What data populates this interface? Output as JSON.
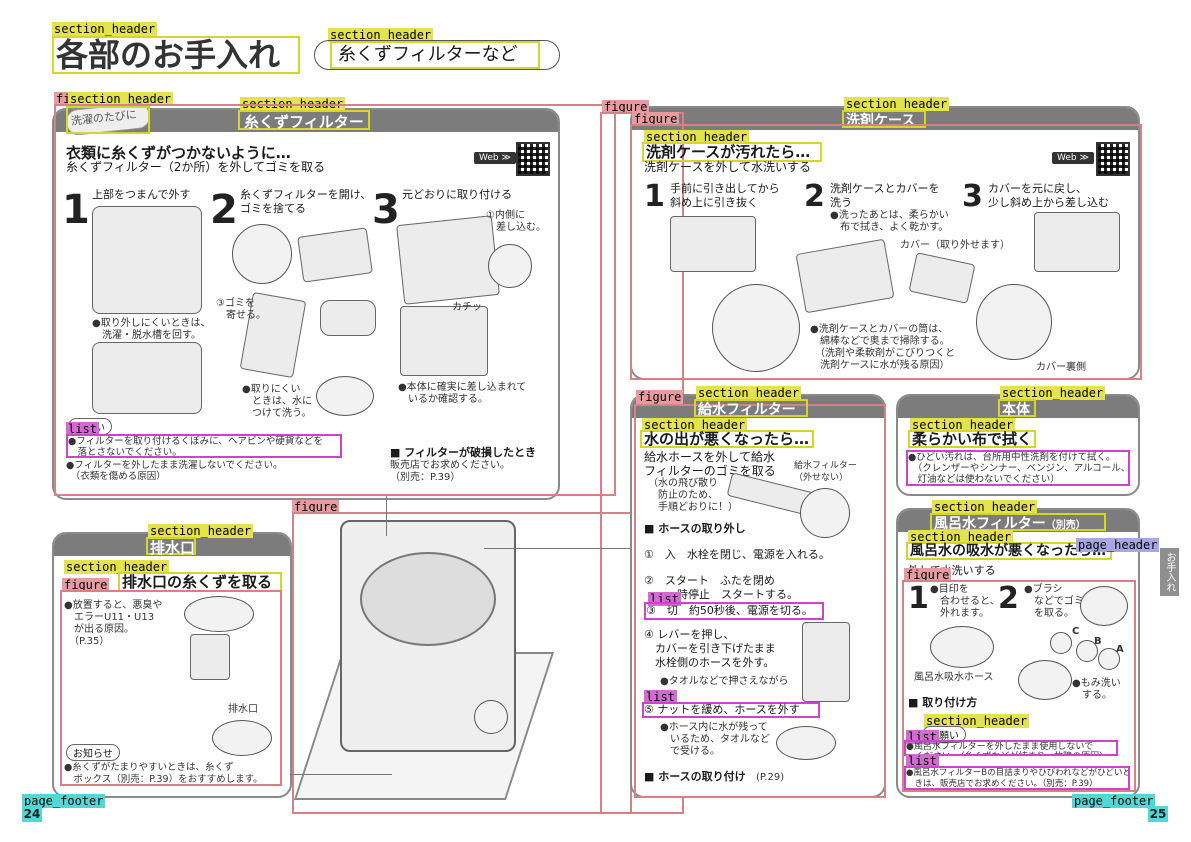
{
  "title": {
    "main": "各部のお手入れ",
    "sub": "糸くずフィルターなど"
  },
  "tags": {
    "section_header": "section_header",
    "figure": "figure",
    "list": "list",
    "page_footer": "page_footer",
    "page_header": "page_header"
  },
  "lint": {
    "band": "糸くずフィルター",
    "badge": "洗濯のたびに",
    "heading": "衣類に糸くずがつかないように…",
    "subheading": "糸くずフィルター（2か所）を外してゴミを取る",
    "web": "Web ≫",
    "steps": [
      {
        "num": "1",
        "text": "上部をつまんで外す"
      },
      {
        "num": "2",
        "text": "糸くずフィルターを開け、\nゴミを捨てる"
      },
      {
        "num": "3",
        "text": "元どおりに取り付ける"
      }
    ],
    "notes": {
      "n1": "●取り外しにくいときは、\n　洗濯・脱水槽を回す。",
      "n2": "③ゴミを\n　寄せる。",
      "n3": "●取りにくい\n　ときは、水に\n　つけて洗う。",
      "n4": "●本体に確実に差し込まれて\n　いるか確認する。",
      "n5": "①内側に\n　差し込む。",
      "click": "カチッ"
    },
    "caution_label": "お願い",
    "caution_items": [
      "●フィルターを取り付けるくぼみに、ヘアピンや硬貨などを\n　落とさないでください。",
      "●フィルターを外したまま洗濯しないでください。\n　（衣類を傷める原因）"
    ],
    "broken_title": "■ フィルターが破損したとき",
    "broken_text": "販売店でお求めください。\n（別売：P.39）"
  },
  "drain": {
    "band": "排水口",
    "heading": "排水口の糸くずを取る",
    "note": "●放置すると、悪臭や\n　エラーU11・U13\n　が出る原因。\n　（P.35）",
    "part_label": "排水口",
    "info_label": "お知らせ",
    "info_text": "●糸くずがたまりやすいときは、糸くず\n　ボックス（別売：P.39）をおすすめします。"
  },
  "detergent": {
    "band": "洗剤ケース",
    "heading": "洗剤ケースが汚れたら…",
    "subheading": "洗剤ケースを外して水洗いする",
    "web": "Web ≫",
    "steps": [
      {
        "num": "1",
        "text": "手前に引き出してから\n斜め上に引き抜く"
      },
      {
        "num": "2",
        "text": "洗剤ケースとカバーを\n洗う"
      },
      {
        "num": "3",
        "text": "カバーを元に戻し、\n少し斜め上から差し込む"
      }
    ],
    "note1": "●洗ったあとは、柔らかい\n　布で拭き、よく乾かす。",
    "cover_label": "カバー（取り外せます）",
    "note2": "●洗剤ケースとカバーの筒は、\n　綿棒などで奥まで掃除する。\n　（洗剤や柔軟剤がこびりつくと\n　洗剤ケースに水が残る原因）",
    "back_label": "カバー裏側"
  },
  "supply": {
    "band": "給水フィルター",
    "heading": "水の出が悪くなったら…",
    "subheading": "給水ホースを外して給水\nフィルターのゴミを取る",
    "paren": "（水の飛び散り\n　防止のため、\n　手順どおりに！）",
    "callout": "給水フィルター\n（外せない）",
    "remove_title": "■ ホースの取り外し",
    "step1": "①　入　水栓を閉じ、電源を入れる。",
    "step2": "②　スタート　ふたを閉め\n　　一時停止　スタートする。",
    "step3": "③　切　約50秒後、電源を切る。",
    "step4": "④ レバーを押し、\n　カバーを引き下げたまま\n　水栓側のホースを外す。",
    "towel": "●タオルなどで押さえながら",
    "step5": "⑤ ナットを緩め、ホースを外す",
    "note": "●ホース内に水が残って\n　いるため、タオルなど\n　で受ける。",
    "attach_title": "■ ホースの取り付け",
    "attach_ref": "(P.29)"
  },
  "body": {
    "band": "本体",
    "heading": "柔らかい布で拭く",
    "note": "●ひどい汚れは、台所用中性洗剤を付けて拭く。\n　（クレンザーやシンナー、ベンジン、アルコール、\n　灯油などは使わないでください）"
  },
  "bath": {
    "band": "風呂水フィルター",
    "band_suffix": "（別売）",
    "heading": "風呂水の吸水が悪くなったら…",
    "subheading": "外して水洗いする",
    "step1_num": "1",
    "step1": "●目印を\n　合わせると、\n　外れます。",
    "step2_num": "2",
    "step2": "●ブラシ\n　などでゴミ\n　を取る。",
    "hose_label": "風呂水吸水ホース",
    "rub_note": "●もみ洗い\n　する。",
    "parts": [
      "C",
      "B",
      "A"
    ],
    "attach_title": "■ 取り付け方",
    "caution_label": "お願い",
    "caution_items": [
      "●風呂水フィルターを外したまま使用しないで\n　ください。（糸くずなどが詰まり、故障の原因）",
      "●風呂水フィルターBの目詰まりやひびわれなどがひどいと\n　きは、販売店でお求めください。（別売：P.39）"
    ]
  },
  "side_tab": "お手入れ",
  "footer": {
    "left_page": "24",
    "right_page": "25"
  }
}
